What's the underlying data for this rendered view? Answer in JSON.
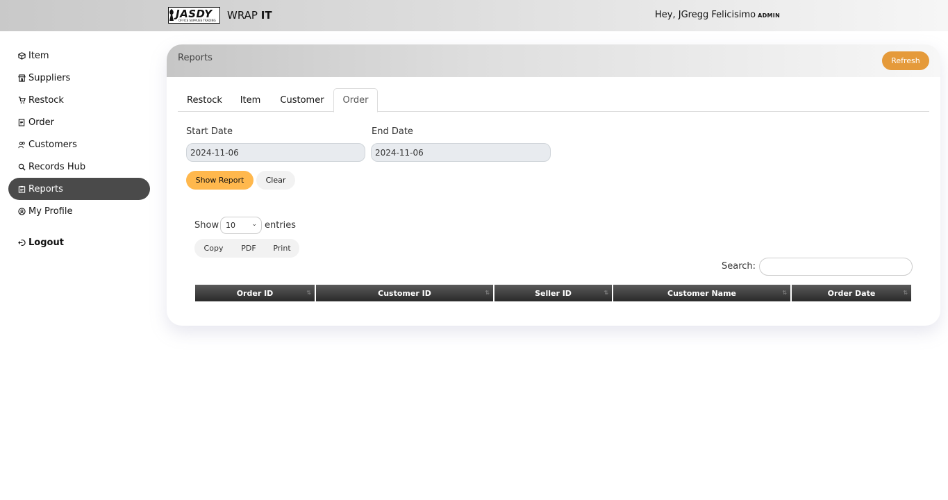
{
  "header": {
    "logo_text": "JASDY",
    "logo_tagline": "OFFICE SUPPLIES TRADING",
    "app_name_prefix": "WRAP",
    "app_name_suffix": "IT",
    "greeting": "Hey, JGregg Felicisimo",
    "role": "ADMIN"
  },
  "sidebar": {
    "items": [
      {
        "label": "Item",
        "icon": "box-icon"
      },
      {
        "label": "Suppliers",
        "icon": "store-icon"
      },
      {
        "label": "Restock",
        "icon": "cart-icon"
      },
      {
        "label": "Order",
        "icon": "receipt-icon"
      },
      {
        "label": "Customers",
        "icon": "users-icon"
      },
      {
        "label": "Records Hub",
        "icon": "search-icon"
      },
      {
        "label": "Reports",
        "icon": "clipboard-icon",
        "active": true
      },
      {
        "label": "My Profile",
        "icon": "user-circle-icon"
      }
    ],
    "logout_label": "Logout"
  },
  "page": {
    "title": "Reports",
    "refresh_label": "Refresh",
    "tabs": [
      "Restock",
      "Item",
      "Customer",
      "Order"
    ],
    "active_tab": "Order"
  },
  "filters": {
    "start_date_label": "Start Date",
    "start_date_value": "2024-11-06",
    "end_date_label": "End Date",
    "end_date_value": "2024-11-06",
    "show_report_label": "Show Report",
    "clear_label": "Clear"
  },
  "table_controls": {
    "show_label": "Show",
    "entries_value": "10",
    "entries_label": "entries",
    "buttons": [
      "Copy",
      "PDF",
      "Print"
    ],
    "search_label": "Search:"
  },
  "table": {
    "columns": [
      "Order ID",
      "Customer ID",
      "Seller ID",
      "Customer Name",
      "Order Date"
    ]
  },
  "colors": {
    "accent_orange": "#e59a3a",
    "show_report_yellow": "#ffb84d",
    "active_nav": "#4a4a4a",
    "table_header": "#2a2a2a"
  }
}
